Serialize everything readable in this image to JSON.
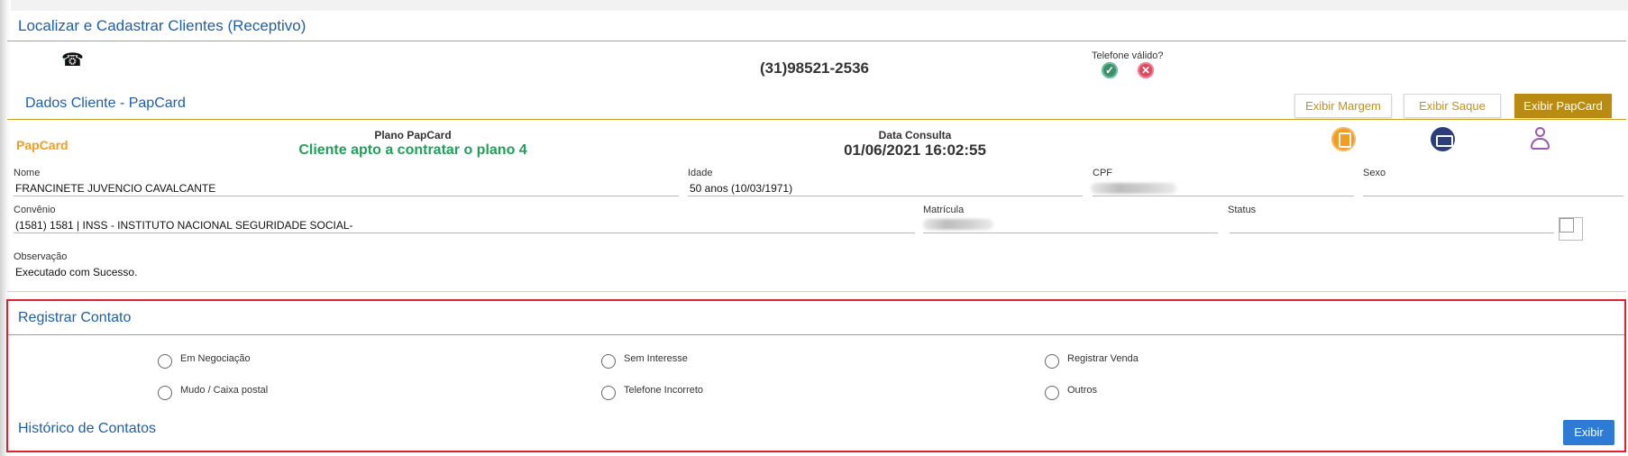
{
  "header": {
    "title": "Localizar e Cadastrar Clientes (Receptivo)"
  },
  "phone": {
    "icon": "telephone-icon",
    "number": "(31)98521-2536",
    "valid_label": "Telefone válido?",
    "confirm_icon": "check-circle-icon",
    "reject_icon": "x-circle-icon"
  },
  "client_section": {
    "title": "Dados Cliente - PapCard",
    "tabs": [
      {
        "label": "Exibir Margem",
        "active": false
      },
      {
        "label": "Exibir Saque",
        "active": false
      },
      {
        "label": "Exibir PapCard",
        "active": true
      }
    ]
  },
  "papcard": {
    "label": "PapCard",
    "plan_heading": "Plano PapCard",
    "plan_value": "Cliente apto a contratar o plano 4",
    "date_heading": "Data Consulta",
    "date_value": "01/06/2021 16:02:55",
    "icons": [
      "document-edit-icon",
      "printer-icon",
      "user-icon"
    ]
  },
  "fields": {
    "nome": {
      "label": "Nome",
      "value": "FRANCINETE JUVENCIO CAVALCANTE"
    },
    "idade": {
      "label": "Idade",
      "value": "50 anos (10/03/1971)"
    },
    "cpf": {
      "label": "CPF",
      "value": ""
    },
    "sexo": {
      "label": "Sexo",
      "value": ""
    },
    "convenio": {
      "label": "Convênio",
      "value": "(1581) 1581 | INSS - INSTITUTO NACIONAL SEGURIDADE SOCIAL-"
    },
    "matricula": {
      "label": "Matrícula",
      "value": ""
    },
    "status": {
      "label": "Status",
      "value": ""
    },
    "observacao": {
      "label": "Observação",
      "value": "Executado com Sucesso."
    }
  },
  "contact": {
    "title": "Registrar Contato",
    "options": [
      "Em Negociação",
      "Sem Interesse",
      "Registrar Venda",
      "Mudo / Caixa postal",
      "Telefone Incorreto",
      "Outros"
    ],
    "history_title": "Histórico de Contatos",
    "show_button": "Exibir"
  },
  "colors": {
    "title_blue": "#1f5fa8",
    "gold": "#c9a227",
    "highlight_red": "#e5202e",
    "plan_green": "#22a05a",
    "papcard_orange": "#f39c1f"
  }
}
